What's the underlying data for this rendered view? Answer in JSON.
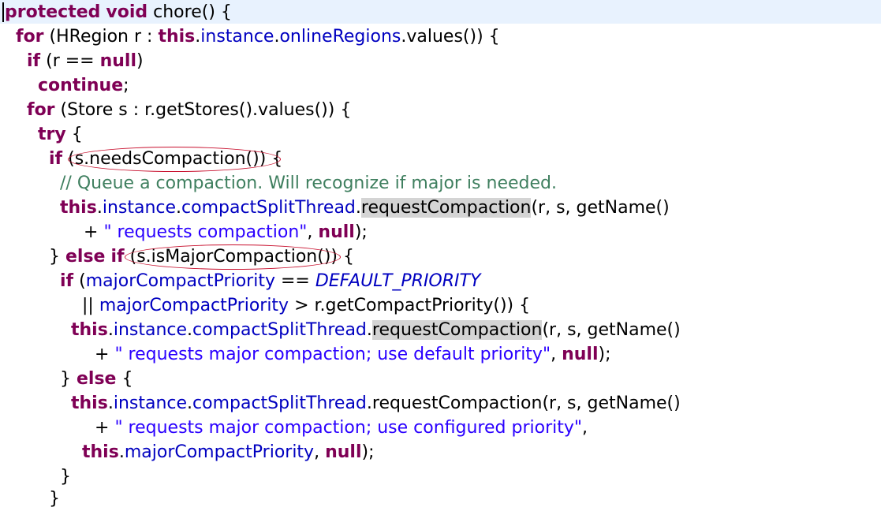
{
  "code": {
    "l1": {
      "kw1": "protected",
      "kw2": "void",
      "t1": "chore() {"
    },
    "l2": {
      "kw1": "for",
      "t1": "(HRegion r : ",
      "kw2": "this",
      "t2": ".",
      "f1": "instance",
      "t3": ".",
      "f2": "onlineRegions",
      "t4": ".values()) {"
    },
    "l3": {
      "kw1": "if",
      "t1": "(r == ",
      "kw2": "null",
      "t2": ")"
    },
    "l4": {
      "kw1": "continue",
      "t1": ";"
    },
    "l5": {
      "kw1": "for",
      "t1": "(Store s : r.getStores().values()) {"
    },
    "l6": {
      "kw1": "try",
      "t1": "{"
    },
    "l7": {
      "kw1": "if",
      "t1": "(s.needsCompaction()) {"
    },
    "l8": {
      "c1": "// Queue a compaction. Will recognize if major is needed."
    },
    "l9": {
      "kw1": "this",
      "t1": ".",
      "f1": "instance",
      "t2": ".",
      "f2": "compactSplitThread",
      "t3": ".",
      "h1": "requestCompaction",
      "t4": "(r, s, getName()"
    },
    "l10": {
      "t1": "+ ",
      "s1": "\" requests compaction\"",
      "t2": ", ",
      "kw1": "null",
      "t3": ");"
    },
    "l11": {
      "t1": "} ",
      "kw1": "else",
      "kw2": "if",
      "t2": "(s.isMajorCompaction()) {"
    },
    "l12": {
      "kw1": "if",
      "t1": "(",
      "f1": "majorCompactPriority",
      "t2": " == ",
      "st1": "DEFAULT_PRIORITY"
    },
    "l13": {
      "t1": "|| ",
      "f1": "majorCompactPriority",
      "t2": " > r.getCompactPriority()) {"
    },
    "l14": {
      "kw1": "this",
      "t1": ".",
      "f1": "instance",
      "t2": ".",
      "f2": "compactSplitThread",
      "t3": ".",
      "h1": "requestCompaction",
      "t4": "(r, s, getName()"
    },
    "l15": {
      "t1": "+ ",
      "s1": "\" requests major compaction; use default priority\"",
      "t2": ", ",
      "kw1": "null",
      "t3": ");"
    },
    "l16": {
      "t1": "} ",
      "kw1": "else",
      "t2": " {"
    },
    "l17": {
      "kw1": "this",
      "t1": ".",
      "f1": "instance",
      "t2": ".",
      "f2": "compactSplitThread",
      "t3": ".requestCompaction(r, s, getName()"
    },
    "l18": {
      "t1": "+ ",
      "s1": "\" requests major compaction; use configured priority\"",
      "t2": ","
    },
    "l19": {
      "kw1": "this",
      "t1": ".",
      "f1": "majorCompactPriority",
      "t2": ", ",
      "kw2": "null",
      "t3": ");"
    },
    "l20": {
      "t1": "}"
    },
    "l21": {
      "t1": "}"
    }
  },
  "colors": {
    "keyword": "#7f0055",
    "field": "#0000c0",
    "string": "#2a00ff",
    "comment": "#3f7f5f",
    "highlight": "#d4d4d4",
    "annotation": "#c8102e"
  }
}
